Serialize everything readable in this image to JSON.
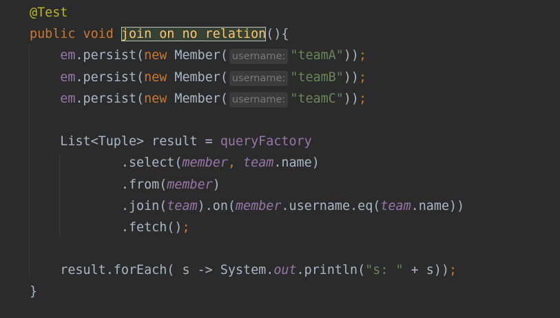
{
  "code": {
    "lines": [
      {
        "indent": 0,
        "tokens": [
          {
            "t": "@Test",
            "c": "ann"
          }
        ]
      },
      {
        "indent": 0,
        "tokens": [
          {
            "t": "public void ",
            "c": "kw"
          },
          {
            "t": "join_on_no_relation",
            "c": "decl"
          },
          {
            "t": "(){",
            "c": "def"
          }
        ]
      },
      {
        "indent": 4,
        "tokens": [
          {
            "t": "em",
            "c": "fld"
          },
          {
            "t": ".persist(",
            "c": "def"
          },
          {
            "t": "new ",
            "c": "kw"
          },
          {
            "t": "Member(",
            "c": "def"
          },
          {
            "t": "username:",
            "c": "hint"
          },
          {
            "t": "\"teamA\"",
            "c": "str"
          },
          {
            "t": "))",
            "c": "def"
          },
          {
            "t": ";",
            "c": "semi"
          }
        ]
      },
      {
        "indent": 4,
        "tokens": [
          {
            "t": "em",
            "c": "fld"
          },
          {
            "t": ".persist(",
            "c": "def"
          },
          {
            "t": "new ",
            "c": "kw"
          },
          {
            "t": "Member(",
            "c": "def"
          },
          {
            "t": "username:",
            "c": "hint"
          },
          {
            "t": "\"teamB\"",
            "c": "str"
          },
          {
            "t": "))",
            "c": "def"
          },
          {
            "t": ";",
            "c": "semi"
          }
        ]
      },
      {
        "indent": 4,
        "tokens": [
          {
            "t": "em",
            "c": "fld"
          },
          {
            "t": ".persist(",
            "c": "def"
          },
          {
            "t": "new ",
            "c": "kw"
          },
          {
            "t": "Member(",
            "c": "def"
          },
          {
            "t": "username:",
            "c": "hint"
          },
          {
            "t": "\"teamC\"",
            "c": "str"
          },
          {
            "t": "))",
            "c": "def"
          },
          {
            "t": ";",
            "c": "semi"
          }
        ]
      },
      {
        "indent": 0,
        "tokens": []
      },
      {
        "indent": 4,
        "tokens": [
          {
            "t": "List<Tuple> result = ",
            "c": "def"
          },
          {
            "t": "queryFactory",
            "c": "fld"
          }
        ]
      },
      {
        "indent": 12,
        "tokens": [
          {
            "t": ".select(",
            "c": "def"
          },
          {
            "t": "member",
            "c": "ital"
          },
          {
            "t": ", ",
            "c": "kw"
          },
          {
            "t": "team",
            "c": "ital"
          },
          {
            "t": ".name)",
            "c": "def"
          }
        ]
      },
      {
        "indent": 12,
        "tokens": [
          {
            "t": ".from(",
            "c": "def"
          },
          {
            "t": "member",
            "c": "ital"
          },
          {
            "t": ")",
            "c": "def"
          }
        ]
      },
      {
        "indent": 12,
        "tokens": [
          {
            "t": ".join(",
            "c": "def"
          },
          {
            "t": "team",
            "c": "ital"
          },
          {
            "t": ").on(",
            "c": "def"
          },
          {
            "t": "member",
            "c": "ital"
          },
          {
            "t": ".username.eq(",
            "c": "def"
          },
          {
            "t": "team",
            "c": "ital"
          },
          {
            "t": ".name))",
            "c": "def"
          }
        ]
      },
      {
        "indent": 12,
        "tokens": [
          {
            "t": ".fetch()",
            "c": "def"
          },
          {
            "t": ";",
            "c": "semi"
          }
        ]
      },
      {
        "indent": 0,
        "tokens": []
      },
      {
        "indent": 4,
        "tokens": [
          {
            "t": "result.forEach( s -> System.",
            "c": "def"
          },
          {
            "t": "out",
            "c": "ital"
          },
          {
            "t": ".println(",
            "c": "def"
          },
          {
            "t": "\"s: \"",
            "c": "str"
          },
          {
            "t": " + s))",
            "c": "def"
          },
          {
            "t": ";",
            "c": "semi"
          }
        ]
      },
      {
        "indent": 0,
        "tokens": [
          {
            "t": "}",
            "c": "def"
          }
        ]
      }
    ]
  }
}
